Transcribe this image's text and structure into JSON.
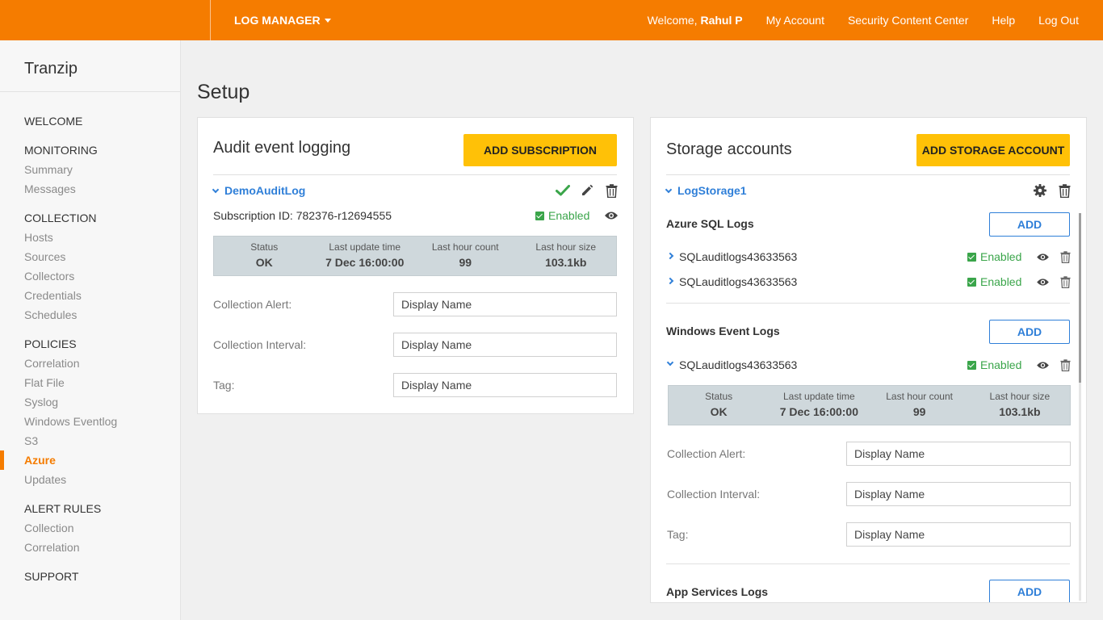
{
  "topbar": {
    "app_menu": "LOG MANAGER",
    "welcome_prefix": "Welcome,",
    "user_name": "Rahul P",
    "links": [
      "My Account",
      "Security Content Center",
      "Help",
      "Log Out"
    ],
    "color": "#f57c00"
  },
  "sidebar": {
    "org": "Tranzip",
    "sections": [
      {
        "title": "WELCOME",
        "items": []
      },
      {
        "title": "MONITORING",
        "items": [
          "Summary",
          "Messages"
        ]
      },
      {
        "title": "COLLECTION",
        "items": [
          "Hosts",
          "Sources",
          "Collectors",
          "Credentials",
          "Schedules"
        ]
      },
      {
        "title": "POLICIES",
        "items": [
          "Correlation",
          "Flat File",
          "Syslog",
          "Windows Eventlog",
          "S3",
          "Azure",
          "Updates"
        ]
      },
      {
        "title": "ALERT RULES",
        "items": [
          "Collection",
          "Correlation"
        ]
      },
      {
        "title": "SUPPORT",
        "items": []
      }
    ],
    "active_item": "Azure"
  },
  "page": {
    "title": "Setup"
  },
  "audit": {
    "title": "Audit event logging",
    "add_button": "ADD SUBSCRIPTION",
    "log_name": "DemoAuditLog",
    "subscription": "Subscription ID: 782376-r12694555",
    "enabled": "Enabled",
    "status": {
      "labels": [
        "Status",
        "Last update time",
        "Last hour count",
        "Last hour size"
      ],
      "values": [
        "OK",
        "7 Dec 16:00:00",
        "99",
        "103.1kb"
      ]
    },
    "form": {
      "alert_label": "Collection Alert:",
      "interval_label": "Collection Interval:",
      "tag_label": "Tag:",
      "placeholder": "Display Name"
    }
  },
  "storage": {
    "title": "Storage accounts",
    "add_button": "ADD STORAGE ACCOUNT",
    "account_name": "LogStorage1",
    "sql": {
      "title": "Azure SQL Logs",
      "add": "ADD",
      "rows": [
        "SQLauditlogs43633563",
        "SQLauditlogs43633563"
      ]
    },
    "windows": {
      "title": "Windows Event Logs",
      "add": "ADD",
      "row": "SQLauditlogs43633563"
    },
    "enabled": "Enabled",
    "status": {
      "labels": [
        "Status",
        "Last update time",
        "Last hour count",
        "Last hour size"
      ],
      "values": [
        "OK",
        "7 Dec 16:00:00",
        "99",
        "103.1kb"
      ]
    },
    "form": {
      "alert_label": "Collection Alert:",
      "interval_label": "Collection Interval:",
      "tag_label": "Tag:",
      "placeholder": "Display Name"
    },
    "app_services": {
      "title": "App Services Logs",
      "add": "ADD"
    }
  }
}
